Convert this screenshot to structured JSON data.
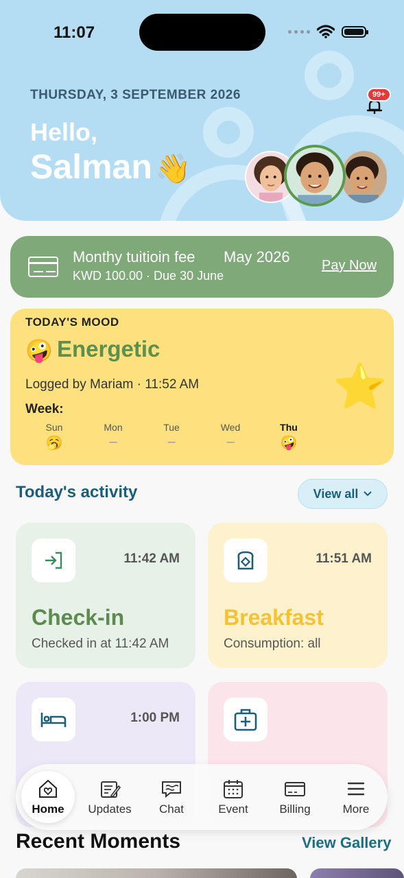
{
  "status_bar": {
    "time": "11:07"
  },
  "header": {
    "date": "THURSDAY, 3 SEPTEMBER 2026",
    "greeting": "Hello,",
    "name": "Salman",
    "wave_emoji": "👋",
    "notification_badge": "99+",
    "bell_icon": "bell-icon"
  },
  "tuition": {
    "title": "Monthy tuitioin fee",
    "month": "May 2026",
    "amount_due": "KWD 100.00 · Due 30 June",
    "action": "Pay Now"
  },
  "mood": {
    "label": "TODAY'S MOOD",
    "emoji": "🤪",
    "value": "Energetic",
    "logged": "Logged by Mariam · 11:52 AM",
    "week_label": "Week:",
    "days": [
      {
        "name": "Sun",
        "mark": "🥱"
      },
      {
        "name": "Mon",
        "mark": "–"
      },
      {
        "name": "Tue",
        "mark": "–"
      },
      {
        "name": "Wed",
        "mark": "–"
      },
      {
        "name": "Thu",
        "mark": "🤪"
      }
    ],
    "star": "⭐"
  },
  "activity": {
    "title": "Today's activity",
    "view_all": "View all",
    "items": [
      {
        "title": "Check-in",
        "time": "11:42 AM",
        "desc": "Checked in at 11:42 AM",
        "icon": "check-in-icon",
        "color": "#5b8c4e",
        "bg": "#e8f1e8"
      },
      {
        "title": "Breakfast",
        "time": "11:51 AM",
        "desc": "Consumption: all",
        "icon": "bread-icon",
        "color": "#f5c233",
        "bg": "#fdf2cd"
      },
      {
        "title": "",
        "time": "1:00 PM",
        "desc": "",
        "icon": "bed-icon",
        "color": "#1b5e78",
        "bg": "#ece8f7"
      },
      {
        "title": "",
        "time": "",
        "desc": "",
        "icon": "medical-kit-icon",
        "color": "#1b5e78",
        "bg": "#fbe4ea"
      }
    ]
  },
  "nav": {
    "items": [
      {
        "label": "Home",
        "icon": "home-icon"
      },
      {
        "label": "Updates",
        "icon": "updates-icon"
      },
      {
        "label": "Chat",
        "icon": "chat-icon"
      },
      {
        "label": "Event",
        "icon": "calendar-icon"
      },
      {
        "label": "Billing",
        "icon": "card-icon"
      },
      {
        "label": "More",
        "icon": "menu-icon"
      }
    ]
  },
  "recent": {
    "title": "Recent Moments",
    "gallery": "View Gallery"
  }
}
